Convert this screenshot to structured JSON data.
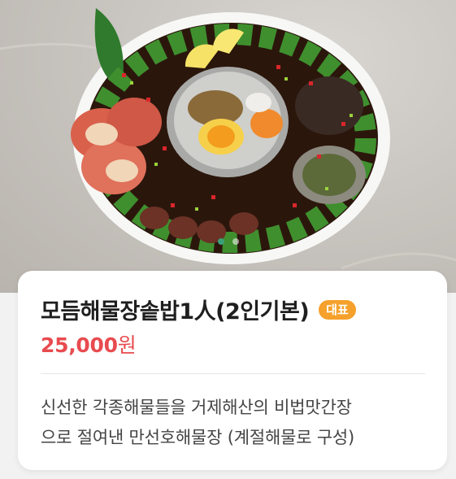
{
  "hero": {
    "image_alt_icon": "seafood-platter-image",
    "slide_count": 2,
    "active_slide": 1
  },
  "menu": {
    "title": "모듬해물장솥밥1人(2인기본)",
    "badge": "대표",
    "price_number": "25,000",
    "price_unit": "원",
    "description_line1": "신선한 각종해물들을 거제해산의 비법맛간장",
    "description_line2": "으로 절여낸 만선호해물장 (계절해물로 구성)"
  },
  "colors": {
    "price": "#e84b4f",
    "badge": "#f5a12b",
    "active_dot": "#3aa07a"
  }
}
